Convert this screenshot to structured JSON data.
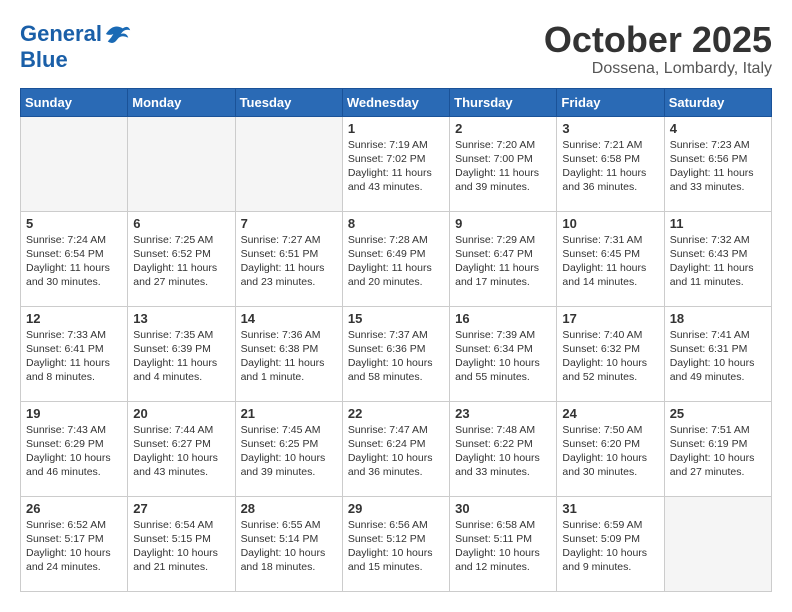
{
  "header": {
    "logo_line1": "General",
    "logo_line2": "Blue",
    "month": "October 2025",
    "location": "Dossena, Lombardy, Italy"
  },
  "weekdays": [
    "Sunday",
    "Monday",
    "Tuesday",
    "Wednesday",
    "Thursday",
    "Friday",
    "Saturday"
  ],
  "weeks": [
    [
      {
        "day": "",
        "info": "",
        "empty": true
      },
      {
        "day": "",
        "info": "",
        "empty": true
      },
      {
        "day": "",
        "info": "",
        "empty": true
      },
      {
        "day": "1",
        "info": "Sunrise: 7:19 AM\nSunset: 7:02 PM\nDaylight: 11 hours\nand 43 minutes."
      },
      {
        "day": "2",
        "info": "Sunrise: 7:20 AM\nSunset: 7:00 PM\nDaylight: 11 hours\nand 39 minutes."
      },
      {
        "day": "3",
        "info": "Sunrise: 7:21 AM\nSunset: 6:58 PM\nDaylight: 11 hours\nand 36 minutes."
      },
      {
        "day": "4",
        "info": "Sunrise: 7:23 AM\nSunset: 6:56 PM\nDaylight: 11 hours\nand 33 minutes."
      }
    ],
    [
      {
        "day": "5",
        "info": "Sunrise: 7:24 AM\nSunset: 6:54 PM\nDaylight: 11 hours\nand 30 minutes."
      },
      {
        "day": "6",
        "info": "Sunrise: 7:25 AM\nSunset: 6:52 PM\nDaylight: 11 hours\nand 27 minutes."
      },
      {
        "day": "7",
        "info": "Sunrise: 7:27 AM\nSunset: 6:51 PM\nDaylight: 11 hours\nand 23 minutes."
      },
      {
        "day": "8",
        "info": "Sunrise: 7:28 AM\nSunset: 6:49 PM\nDaylight: 11 hours\nand 20 minutes."
      },
      {
        "day": "9",
        "info": "Sunrise: 7:29 AM\nSunset: 6:47 PM\nDaylight: 11 hours\nand 17 minutes."
      },
      {
        "day": "10",
        "info": "Sunrise: 7:31 AM\nSunset: 6:45 PM\nDaylight: 11 hours\nand 14 minutes."
      },
      {
        "day": "11",
        "info": "Sunrise: 7:32 AM\nSunset: 6:43 PM\nDaylight: 11 hours\nand 11 minutes."
      }
    ],
    [
      {
        "day": "12",
        "info": "Sunrise: 7:33 AM\nSunset: 6:41 PM\nDaylight: 11 hours\nand 8 minutes."
      },
      {
        "day": "13",
        "info": "Sunrise: 7:35 AM\nSunset: 6:39 PM\nDaylight: 11 hours\nand 4 minutes."
      },
      {
        "day": "14",
        "info": "Sunrise: 7:36 AM\nSunset: 6:38 PM\nDaylight: 11 hours\nand 1 minute."
      },
      {
        "day": "15",
        "info": "Sunrise: 7:37 AM\nSunset: 6:36 PM\nDaylight: 10 hours\nand 58 minutes."
      },
      {
        "day": "16",
        "info": "Sunrise: 7:39 AM\nSunset: 6:34 PM\nDaylight: 10 hours\nand 55 minutes."
      },
      {
        "day": "17",
        "info": "Sunrise: 7:40 AM\nSunset: 6:32 PM\nDaylight: 10 hours\nand 52 minutes."
      },
      {
        "day": "18",
        "info": "Sunrise: 7:41 AM\nSunset: 6:31 PM\nDaylight: 10 hours\nand 49 minutes."
      }
    ],
    [
      {
        "day": "19",
        "info": "Sunrise: 7:43 AM\nSunset: 6:29 PM\nDaylight: 10 hours\nand 46 minutes."
      },
      {
        "day": "20",
        "info": "Sunrise: 7:44 AM\nSunset: 6:27 PM\nDaylight: 10 hours\nand 43 minutes."
      },
      {
        "day": "21",
        "info": "Sunrise: 7:45 AM\nSunset: 6:25 PM\nDaylight: 10 hours\nand 39 minutes."
      },
      {
        "day": "22",
        "info": "Sunrise: 7:47 AM\nSunset: 6:24 PM\nDaylight: 10 hours\nand 36 minutes."
      },
      {
        "day": "23",
        "info": "Sunrise: 7:48 AM\nSunset: 6:22 PM\nDaylight: 10 hours\nand 33 minutes."
      },
      {
        "day": "24",
        "info": "Sunrise: 7:50 AM\nSunset: 6:20 PM\nDaylight: 10 hours\nand 30 minutes."
      },
      {
        "day": "25",
        "info": "Sunrise: 7:51 AM\nSunset: 6:19 PM\nDaylight: 10 hours\nand 27 minutes."
      }
    ],
    [
      {
        "day": "26",
        "info": "Sunrise: 6:52 AM\nSunset: 5:17 PM\nDaylight: 10 hours\nand 24 minutes."
      },
      {
        "day": "27",
        "info": "Sunrise: 6:54 AM\nSunset: 5:15 PM\nDaylight: 10 hours\nand 21 minutes."
      },
      {
        "day": "28",
        "info": "Sunrise: 6:55 AM\nSunset: 5:14 PM\nDaylight: 10 hours\nand 18 minutes."
      },
      {
        "day": "29",
        "info": "Sunrise: 6:56 AM\nSunset: 5:12 PM\nDaylight: 10 hours\nand 15 minutes."
      },
      {
        "day": "30",
        "info": "Sunrise: 6:58 AM\nSunset: 5:11 PM\nDaylight: 10 hours\nand 12 minutes."
      },
      {
        "day": "31",
        "info": "Sunrise: 6:59 AM\nSunset: 5:09 PM\nDaylight: 10 hours\nand 9 minutes."
      },
      {
        "day": "",
        "info": "",
        "empty": true
      }
    ]
  ]
}
